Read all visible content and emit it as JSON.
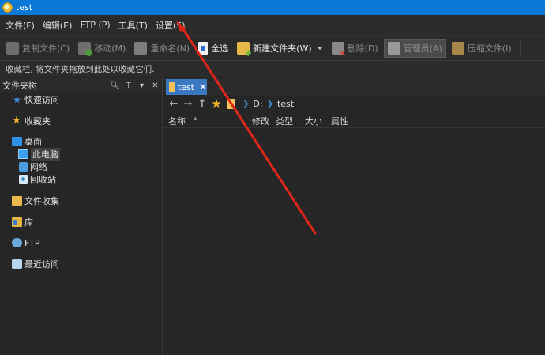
{
  "window": {
    "title": "test"
  },
  "menu": [
    "文件(F)",
    "编辑(E)",
    "FTP (P)",
    "工具(T)",
    "设置(S)"
  ],
  "toolbar": {
    "copy": "复制文件(C)",
    "move": "移动(M)",
    "rename": "重命名(N)",
    "select_all": "全选",
    "new_folder": "新建文件夹(W)",
    "delete": "删除(D)",
    "admin": "管理员(A)",
    "compress": "压缩文件(I)"
  },
  "infobar": {
    "text": "收藏栏, 将文件夹拖放到此处以收藏它们."
  },
  "folder_pane": {
    "title": "文件夹树",
    "items": {
      "quick_access": "快速访问",
      "favorites": "收藏夹",
      "desktop": "桌面",
      "this_pc": "此电脑",
      "network": "网络",
      "recycle_bin": "回收站",
      "file_collection": "文件收集",
      "library": "库",
      "ftp": "FTP",
      "recent": "最近访问"
    }
  },
  "tab": {
    "label": "test"
  },
  "address": {
    "drive": "D:",
    "folder": "test"
  },
  "columns": [
    "名称",
    "修改",
    "类型",
    "大小",
    "属性"
  ],
  "colors": {
    "titlebar": "#0a78d7",
    "tab_active": "#3a78c2",
    "annotation_arrow": "#e0261b"
  }
}
